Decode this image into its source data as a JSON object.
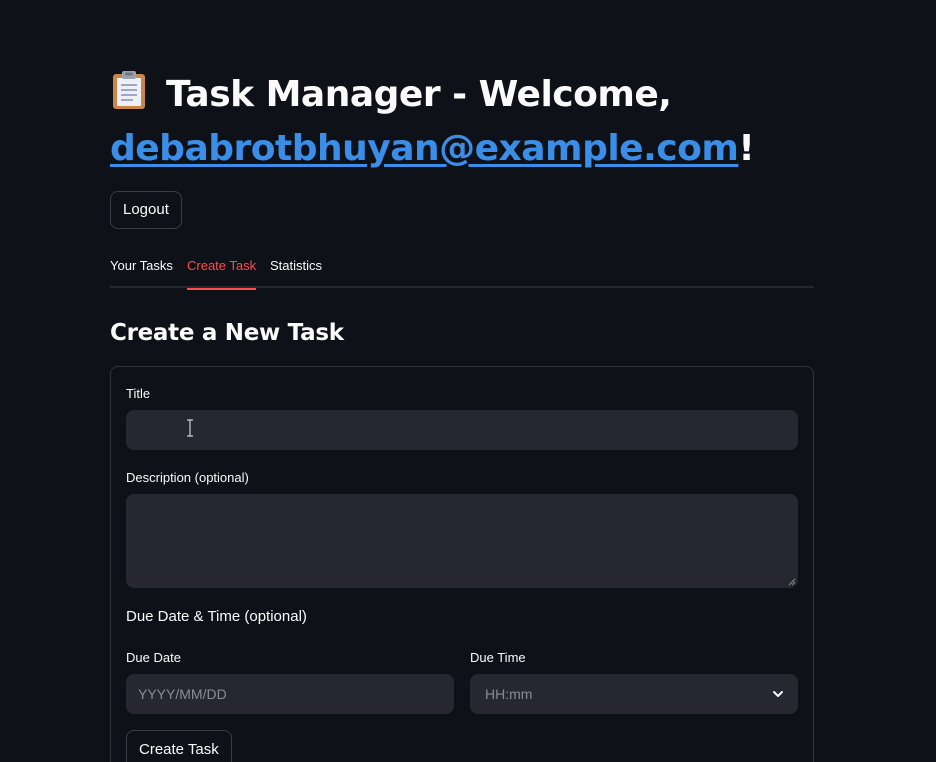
{
  "header": {
    "title_prefix": "Task Manager - Welcome, ",
    "user_email": "debabrotbhuyan@example.com",
    "title_suffix": "!",
    "emoji_icon": "clipboard-icon"
  },
  "actions": {
    "logout_label": "Logout"
  },
  "tabs": [
    {
      "label": "Your Tasks",
      "active": false
    },
    {
      "label": "Create Task",
      "active": true
    },
    {
      "label": "Statistics",
      "active": false
    }
  ],
  "create_task": {
    "heading": "Create a New Task",
    "title_label": "Title",
    "title_value": "",
    "description_label": "Description (optional)",
    "description_value": "",
    "due_section_label": "Due Date & Time (optional)",
    "due_date_label": "Due Date",
    "due_date_placeholder": "YYYY/MM/DD",
    "due_time_label": "Due Time",
    "due_time_placeholder": "HH:mm",
    "submit_label": "Create Task"
  },
  "colors": {
    "background": "#0e1117",
    "accent": "#ff4b4b",
    "link": "#3b8ee8",
    "input_bg": "#262730"
  }
}
